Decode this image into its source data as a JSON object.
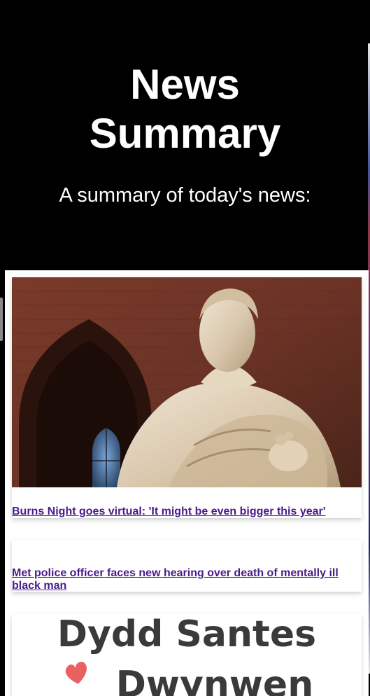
{
  "header": {
    "title": "News Summary",
    "subtitle": "A summary of today's news:"
  },
  "articles": [
    {
      "image_alt": "Statue of Robert Burns",
      "headline": "Burns Night goes virtual: 'It might be even bigger this year'"
    },
    {
      "headline": "Met police officer faces new hearing over death of mentally ill black man"
    },
    {
      "promo_line1": "Dydd Santes",
      "promo_line2": "Dwynwen",
      "promo_icon": "heart-icon"
    }
  ],
  "colors": {
    "header_bg": "#000000",
    "header_text": "#ffffff",
    "link": "#4a1a8a",
    "card_bg": "#ffffff",
    "promo_text": "#3a3a3a",
    "heart": "#e8605f"
  }
}
